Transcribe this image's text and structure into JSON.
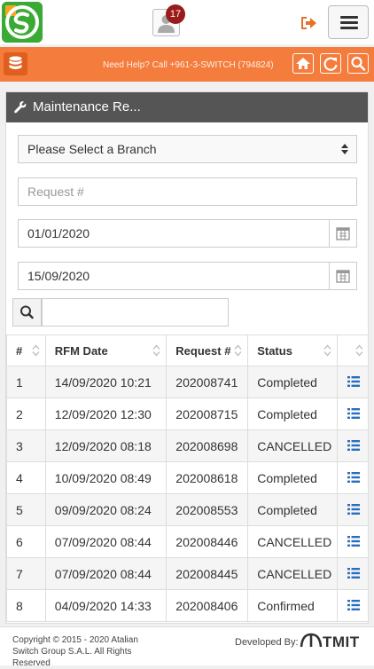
{
  "header": {
    "notification_count": "17"
  },
  "help_bar": {
    "help_text": "Need Help? Call +961-3-SWITCH (794824)"
  },
  "panel": {
    "title": "Maintenance Re..."
  },
  "filters": {
    "branch_selected": "Please Select a Branch",
    "request_placeholder": "Request #",
    "date_from": "01/01/2020",
    "date_to": "15/09/2020"
  },
  "table": {
    "headers": [
      "#",
      "RFM Date",
      "Request #",
      "Status"
    ],
    "rows": [
      {
        "n": "1",
        "date": "14/09/2020 10:21",
        "req": "202008741",
        "status": "Completed"
      },
      {
        "n": "2",
        "date": "12/09/2020 12:30",
        "req": "202008715",
        "status": "Completed"
      },
      {
        "n": "3",
        "date": "12/09/2020 08:18",
        "req": "202008698",
        "status": "CANCELLED"
      },
      {
        "n": "4",
        "date": "10/09/2020 08:49",
        "req": "202008618",
        "status": "Completed"
      },
      {
        "n": "5",
        "date": "09/09/2020 08:24",
        "req": "202008553",
        "status": "Completed"
      },
      {
        "n": "6",
        "date": "07/09/2020 08:44",
        "req": "202008446",
        "status": "CANCELLED"
      },
      {
        "n": "7",
        "date": "07/09/2020 08:44",
        "req": "202008445",
        "status": "CANCELLED"
      },
      {
        "n": "8",
        "date": "04/09/2020 14:33",
        "req": "202008406",
        "status": "Confirmed"
      }
    ]
  },
  "footer": {
    "copyright": "Copyright © 2015 - 2020 Atalian Switch Group S.A.L. All Rights Reserved",
    "developed_by": "Developed By:",
    "developer_logo_text": "TMIT"
  },
  "colors": {
    "accent": "#f47c3c",
    "title_bar": "#555555",
    "badge": "#9b1b1b",
    "list_icon": "#2a6ebb"
  },
  "icons": [
    "app-logo",
    "user-icon",
    "logout-icon",
    "menu-icon",
    "database-icon",
    "home-icon",
    "refresh-icon",
    "search-icon",
    "wrench-icon",
    "calendar-icon",
    "sort-icon",
    "list-icon"
  ]
}
